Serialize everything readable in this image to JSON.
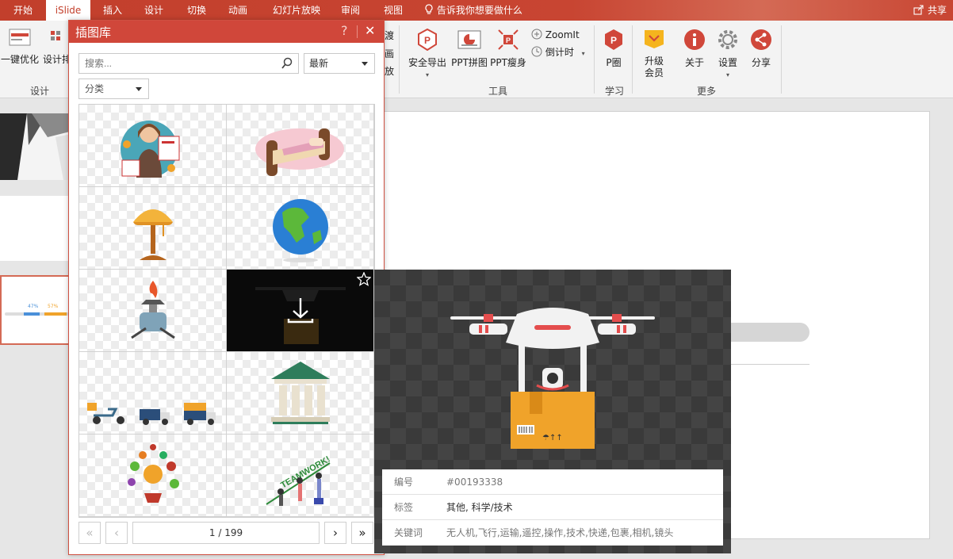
{
  "tabs": [
    {
      "label": "开始",
      "active": false
    },
    {
      "label": "iSlide",
      "active": true
    },
    {
      "label": "插入",
      "active": false
    },
    {
      "label": "设计",
      "active": false
    },
    {
      "label": "切换",
      "active": false
    },
    {
      "label": "动画",
      "active": false
    },
    {
      "label": "幻灯片放映",
      "active": false
    },
    {
      "label": "审阅",
      "active": false
    },
    {
      "label": "视图",
      "active": false
    }
  ],
  "tell_me": "告诉我你想要做什么",
  "share_label": "共享",
  "ribbon": {
    "one_click_label": "一键优化",
    "design_layout_label": "设计排",
    "design_group_label": "设计",
    "partial_buttons": [
      "渡",
      "画",
      "放"
    ],
    "safe_export_label": "安全导出",
    "ppt_collage_label": "PPT拼图",
    "ppt_slim_label": "PPT瘦身",
    "zoomit_label": "ZoomIt",
    "countdown_label": "倒计时",
    "tools_group_label": "工具",
    "p_garden_label": "P圈",
    "learn_group_label": "学习",
    "upgrade_label_1": "升级",
    "upgrade_label_2": "会员",
    "about_label": "关于",
    "settings_label": "设置",
    "share_btn_label": "分享",
    "more_group_label": "更多"
  },
  "thumb_labels": [
    "47%",
    "57%"
  ],
  "panel": {
    "title": "插图库",
    "help": "?",
    "close": "✕",
    "search_placeholder": "搜索...",
    "sort_value": "最新",
    "category_value": "分类",
    "page_text": "1 / 199"
  },
  "preview": {
    "id_key": "编号",
    "id_value": "#00193338",
    "tags_key": "标签",
    "tags_value": "其他, 科学/技术",
    "keywords_key": "关键词",
    "keywords_value": "无人机,飞行,运输,遥控,操作,技术,快递,包裹,相机,镜头"
  },
  "teamwork_text": "TEAMWORK!",
  "colors": {
    "brand_red": "#c84532",
    "panel_header": "#d0473a",
    "accent_orange": "#f0a32a"
  }
}
